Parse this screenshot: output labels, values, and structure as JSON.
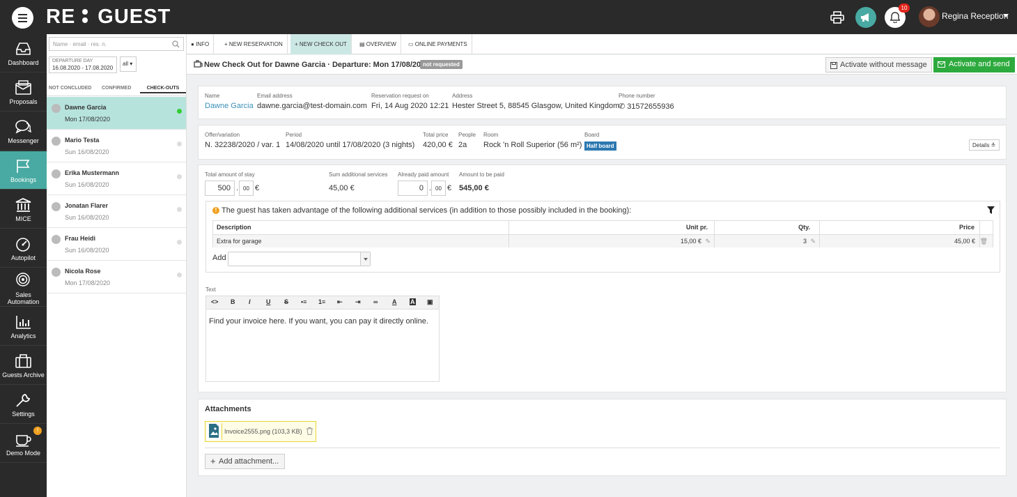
{
  "app": {
    "logo_left": "RE",
    "logo_right": "GUEST",
    "notifications_count": "10",
    "user_name": "Regina Reception"
  },
  "sidebar": {
    "items": [
      {
        "label": "Dashboard",
        "icon": "inbox-icon"
      },
      {
        "label": "Proposals",
        "icon": "proposals-icon"
      },
      {
        "label": "Messenger",
        "icon": "chat-icon"
      },
      {
        "label": "Bookings",
        "icon": "flag-icon",
        "active": true
      },
      {
        "label": "MICE",
        "icon": "building-icon"
      },
      {
        "label": "Autopilot",
        "icon": "gauge-icon"
      },
      {
        "label": "Sales",
        "label2": "Automation",
        "icon": "target-icon"
      },
      {
        "label": "Analytics",
        "icon": "chart-icon"
      },
      {
        "label": "Guests Archive",
        "icon": "suitcase-icon"
      },
      {
        "label": "Settings",
        "icon": "wrench-icon"
      },
      {
        "label": "Demo Mode",
        "icon": "cup-icon",
        "badge": "!"
      }
    ]
  },
  "list": {
    "search_placeholder": "Name · email · res. n.",
    "filter_label": "DEPARTURE DAY",
    "filter_value": "16.08.2020 - 17.08.2020",
    "all_label": "all",
    "tabs": [
      "NOT CONCLUDED",
      "CONFIRMED",
      "CHECK-OUTS"
    ],
    "guests": [
      {
        "name": "Dawne Garcia",
        "date": "Mon 17/08/2020"
      },
      {
        "name": "Mario Testa",
        "date": "Sun 16/08/2020"
      },
      {
        "name": "Erika Mustermann",
        "date": "Sun 16/08/2020"
      },
      {
        "name": "Jonatan Flarer",
        "date": "Sun 16/08/2020"
      },
      {
        "name": "Frau Heidi",
        "date": "Sun 16/08/2020"
      },
      {
        "name": "Nicola Rose",
        "date": "Mon 17/08/2020"
      }
    ]
  },
  "toolbar": {
    "info": "INFO",
    "new_reservation": "NEW RESERVATION",
    "new_checkout": "NEW CHECK OUT",
    "overview": "OVERVIEW",
    "online_payments": "ONLINE PAYMENTS"
  },
  "header": {
    "title": "New Check Out for Dawne Garcia · Departure: Mon 17/08/2020",
    "status": "not requested",
    "activate_without": "Activate without message",
    "activate_send": "Activate and send"
  },
  "guest": {
    "name_label": "Name",
    "name": "Dawne Garcia",
    "email_label": "Email address",
    "email": "dawne.garcia@test-domain.com",
    "request_label": "Reservation request on",
    "request": "Fri, 14 Aug 2020 12:21",
    "address_label": "Address",
    "address": "Hester Street 5, 88545 Glasgow, United Kingdom",
    "phone_label": "Phone number",
    "phone": "31572655936"
  },
  "offer": {
    "offer_label": "Offer/variation",
    "offer": "N. 32238/2020 / var. 1",
    "period_label": "Period",
    "period": "14/08/2020 until 17/08/2020 (3 nights)",
    "price_label": "Total price",
    "price": "420,00 €",
    "people_label": "People",
    "people": "2a",
    "room_label": "Room",
    "room": "Rock 'n Roll Superior (56 m²)",
    "board_label": "Board",
    "board": "Half board",
    "details": "Details"
  },
  "payment": {
    "total_label": "Total amount of stay",
    "total_int": "500",
    "total_dec": "00",
    "currency": "€",
    "sum_label": "Sum additional services",
    "sum": "45,00 €",
    "paid_label": "Already paid amount",
    "paid_int": "0",
    "paid_dec": "00",
    "due_label": "Amount to be paid",
    "due": "545,00 €",
    "notice": "The guest has taken advantage of the following additional services (in addition to those possibly included in the booking):",
    "columns": [
      "Description",
      "Unit pr.",
      "Qty.",
      "Price"
    ],
    "rows": [
      {
        "description": "Extra for garage",
        "unit": "15,00 €",
        "qty": "3",
        "price": "45,00 €"
      }
    ],
    "add_label": "Add"
  },
  "text": {
    "label": "Text",
    "toolbar": [
      "<>",
      "B",
      "I",
      "U",
      "S",
      "•≡",
      "1≡",
      "⇤",
      "⇥",
      "∞",
      "A",
      "A",
      "▣"
    ],
    "body": "Find your invoice here. If you want, you can pay it directly online."
  },
  "attachments": {
    "title": "Attachments",
    "file": "Invoice2555.png (103,3 KB)",
    "add": "Add attachment..."
  },
  "colors": {
    "accent": "#48aaa2",
    "green": "#2daa3d",
    "topbar": "#2a2a2a",
    "board": "#2c78b0"
  }
}
